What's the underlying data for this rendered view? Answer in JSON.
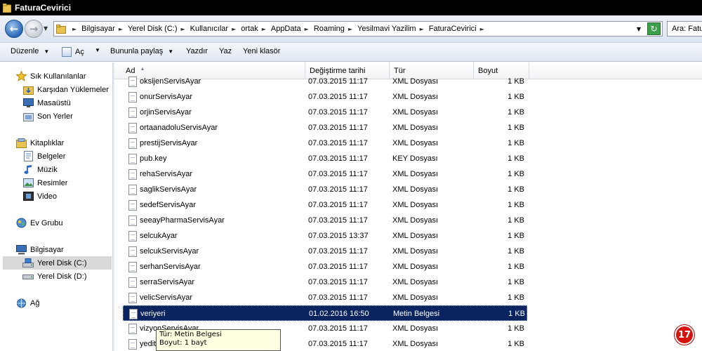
{
  "window": {
    "title": "FaturaCevirici"
  },
  "address": {
    "crumbs": [
      "Bilgisayar",
      "Yerel Disk (C:)",
      "Kullanıcılar",
      "ortak",
      "AppData",
      "Roaming",
      "Yesilmavi Yazilim",
      "FaturaCevirici"
    ],
    "search_placeholder": "Ara: Fatu"
  },
  "toolbar": {
    "organize": "Düzenle",
    "open": "Aç",
    "share": "Bununla paylaş",
    "print": "Yazdır",
    "burn": "Yaz",
    "new_folder": "Yeni klasör"
  },
  "sidebar": {
    "favorites": {
      "label": "Sık Kullanılanlar",
      "items": [
        "Karşıdan Yüklemeler",
        "Masaüstü",
        "Son Yerler"
      ]
    },
    "libraries": {
      "label": "Kitaplıklar",
      "items": [
        "Belgeler",
        "Müzik",
        "Resimler",
        "Video"
      ]
    },
    "homegroup": "Ev Grubu",
    "computer": {
      "label": "Bilgisayar",
      "items": [
        "Yerel Disk (C:)",
        "Yerel Disk (D:)"
      ],
      "selected": "Yerel Disk (C:)"
    },
    "network": "Ağ"
  },
  "columns": {
    "name": "Ad",
    "date": "Değiştirme tarihi",
    "type": "Tür",
    "size": "Boyut"
  },
  "files": [
    {
      "name": "oksijenServisAyar",
      "date": "07.03.2015 11:17",
      "type": "XML Dosyası",
      "size": "1 KB"
    },
    {
      "name": "onurServisAyar",
      "date": "07.03.2015 11:17",
      "type": "XML Dosyası",
      "size": "1 KB"
    },
    {
      "name": "orjinServisAyar",
      "date": "07.03.2015 11:17",
      "type": "XML Dosyası",
      "size": "1 KB"
    },
    {
      "name": "ortaanadoluServisAyar",
      "date": "07.03.2015 11:17",
      "type": "XML Dosyası",
      "size": "1 KB"
    },
    {
      "name": "prestijServisAyar",
      "date": "07.03.2015 11:17",
      "type": "XML Dosyası",
      "size": "1 KB"
    },
    {
      "name": "pub.key",
      "date": "07.03.2015 11:17",
      "type": "KEY Dosyası",
      "size": "1 KB"
    },
    {
      "name": "rehaServisAyar",
      "date": "07.03.2015 11:17",
      "type": "XML Dosyası",
      "size": "1 KB"
    },
    {
      "name": "saglikServisAyar",
      "date": "07.03.2015 11:17",
      "type": "XML Dosyası",
      "size": "1 KB"
    },
    {
      "name": "sedefServisAyar",
      "date": "07.03.2015 11:17",
      "type": "XML Dosyası",
      "size": "1 KB"
    },
    {
      "name": "seeayPharmaServisAyar",
      "date": "07.03.2015 11:17",
      "type": "XML Dosyası",
      "size": "1 KB"
    },
    {
      "name": "selcukAyar",
      "date": "07.03.2015 13:37",
      "type": "XML Dosyası",
      "size": "1 KB"
    },
    {
      "name": "selcukServisAyar",
      "date": "07.03.2015 11:17",
      "type": "XML Dosyası",
      "size": "1 KB"
    },
    {
      "name": "serhanServisAyar",
      "date": "07.03.2015 11:17",
      "type": "XML Dosyası",
      "size": "1 KB"
    },
    {
      "name": "serraServisAyar",
      "date": "07.03.2015 11:17",
      "type": "XML Dosyası",
      "size": "1 KB"
    },
    {
      "name": "velicServisAyar",
      "date": "07.03.2015 11:17",
      "type": "XML Dosyası",
      "size": "1 KB"
    },
    {
      "name": "veriyeri",
      "date": "01.02.2016 16:50",
      "type": "Metin Belgesi",
      "size": "1 KB",
      "selected": true
    },
    {
      "name": "vizyonServisAyar",
      "date": "07.03.2015 11:17",
      "type": "XML Dosyası",
      "size": "1 KB"
    },
    {
      "name": "yeditepeServisAyar",
      "date": "07.03.2015 11:17",
      "type": "XML Dosyası",
      "size": "1 KB"
    }
  ],
  "tooltip": {
    "lines": [
      "Tür: Metin Belgesi",
      "Boyut: 1 bayt"
    ]
  },
  "badge": "17",
  "colors": {
    "selection": "#0a2460",
    "tooltip_bg": "#ffffe1",
    "badge": "#d4140f"
  }
}
